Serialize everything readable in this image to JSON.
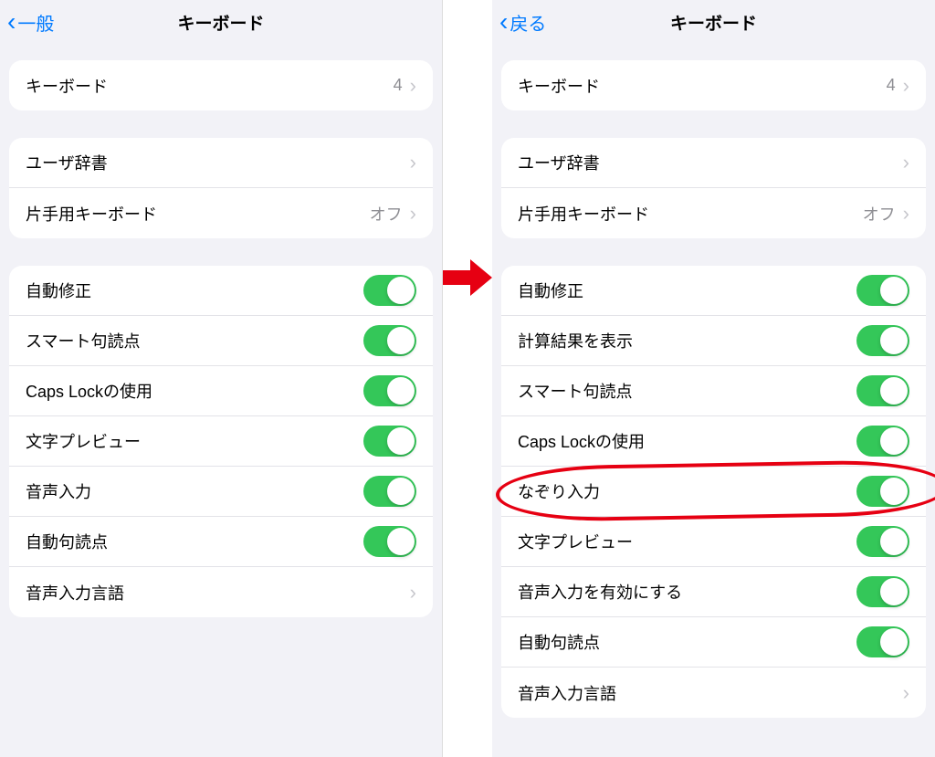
{
  "left": {
    "back_label": "一般",
    "title": "キーボード",
    "g1": [
      {
        "label": "キーボード",
        "value": "4",
        "type": "nav"
      }
    ],
    "g2": [
      {
        "label": "ユーザ辞書",
        "type": "nav"
      },
      {
        "label": "片手用キーボード",
        "value": "オフ",
        "type": "nav"
      }
    ],
    "g3": [
      {
        "label": "自動修正",
        "type": "switch",
        "on": true
      },
      {
        "label": "スマート句読点",
        "type": "switch",
        "on": true
      },
      {
        "label": "Caps Lockの使用",
        "type": "switch",
        "on": true
      },
      {
        "label": "文字プレビュー",
        "type": "switch",
        "on": true
      },
      {
        "label": "音声入力",
        "type": "switch",
        "on": true
      },
      {
        "label": "自動句読点",
        "type": "switch",
        "on": true
      },
      {
        "label": "音声入力言語",
        "type": "nav"
      }
    ]
  },
  "right": {
    "back_label": "戻る",
    "title": "キーボード",
    "g1": [
      {
        "label": "キーボード",
        "value": "4",
        "type": "nav"
      }
    ],
    "g2": [
      {
        "label": "ユーザ辞書",
        "type": "nav"
      },
      {
        "label": "片手用キーボード",
        "value": "オフ",
        "type": "nav"
      }
    ],
    "g3": [
      {
        "label": "自動修正",
        "type": "switch",
        "on": true
      },
      {
        "label": "計算結果を表示",
        "type": "switch",
        "on": true
      },
      {
        "label": "スマート句読点",
        "type": "switch",
        "on": true
      },
      {
        "label": "Caps Lockの使用",
        "type": "switch",
        "on": true
      },
      {
        "label": "なぞり入力",
        "type": "switch",
        "on": true,
        "highlight": true
      },
      {
        "label": "文字プレビュー",
        "type": "switch",
        "on": true
      },
      {
        "label": "音声入力を有効にする",
        "type": "switch",
        "on": true
      },
      {
        "label": "自動句読点",
        "type": "switch",
        "on": true
      },
      {
        "label": "音声入力言語",
        "type": "nav"
      }
    ]
  },
  "arrow_color": "#e60012"
}
